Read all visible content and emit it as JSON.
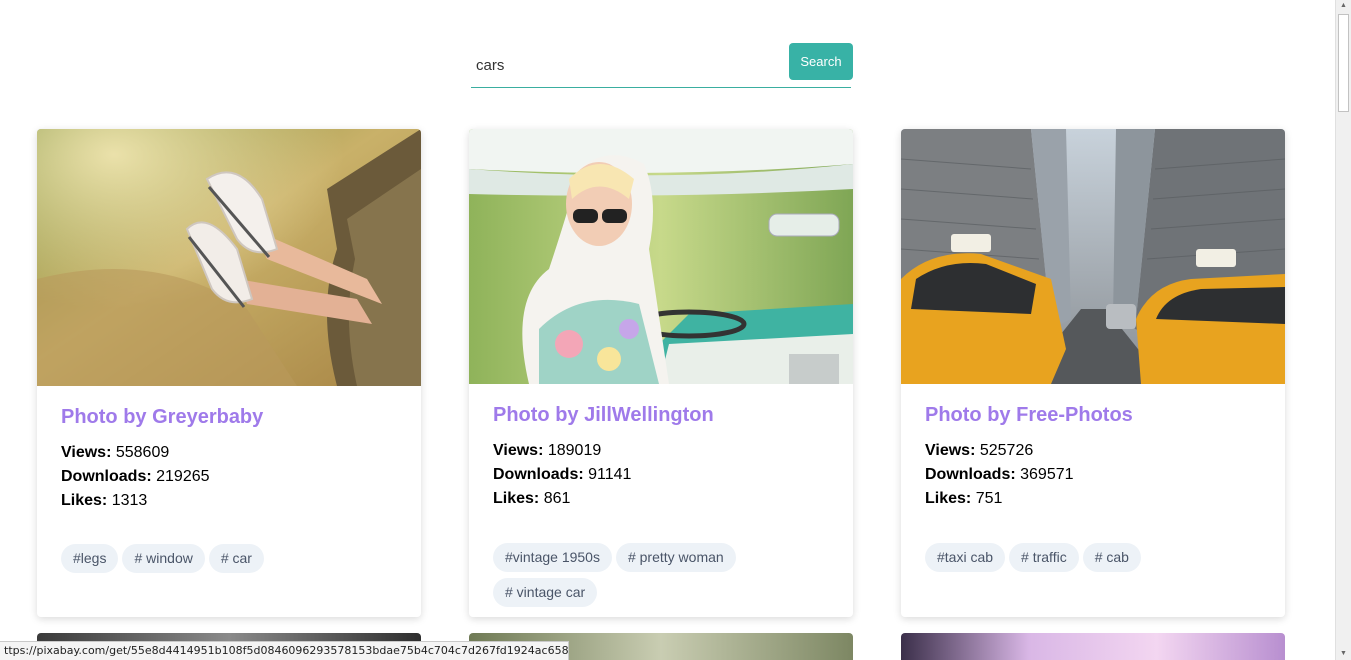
{
  "search": {
    "value": "cars",
    "button_label": "Search"
  },
  "cards": [
    {
      "title": "Photo by Greyerbaby",
      "views_label": "Views:",
      "views": "558609",
      "downloads_label": "Downloads:",
      "downloads": "219265",
      "likes_label": "Likes:",
      "likes": "1313",
      "tags": [
        "#legs",
        "# window",
        "# car"
      ]
    },
    {
      "title": "Photo by JillWellington",
      "views_label": "Views:",
      "views": "189019",
      "downloads_label": "Downloads:",
      "downloads": "91141",
      "likes_label": "Likes:",
      "likes": "861",
      "tags": [
        "#vintage 1950s",
        "# pretty woman",
        "# vintage car"
      ]
    },
    {
      "title": "Photo by Free-Photos",
      "views_label": "Views:",
      "views": "525726",
      "downloads_label": "Downloads:",
      "downloads": "369571",
      "likes_label": "Likes:",
      "likes": "751",
      "tags": [
        "#taxi cab",
        "# traffic",
        "# cab"
      ]
    }
  ],
  "status_bar": {
    "url": "ttps://pixabay.com/get/55e8d4414951b108f5d0846096293578153bdae75b4c704c7d267fd1924ac658_1280.jpg"
  },
  "colors": {
    "accent": "#38b2a6",
    "title": "#9f7aea",
    "tag_bg": "#edf2f7",
    "tag_text": "#4a5568"
  }
}
